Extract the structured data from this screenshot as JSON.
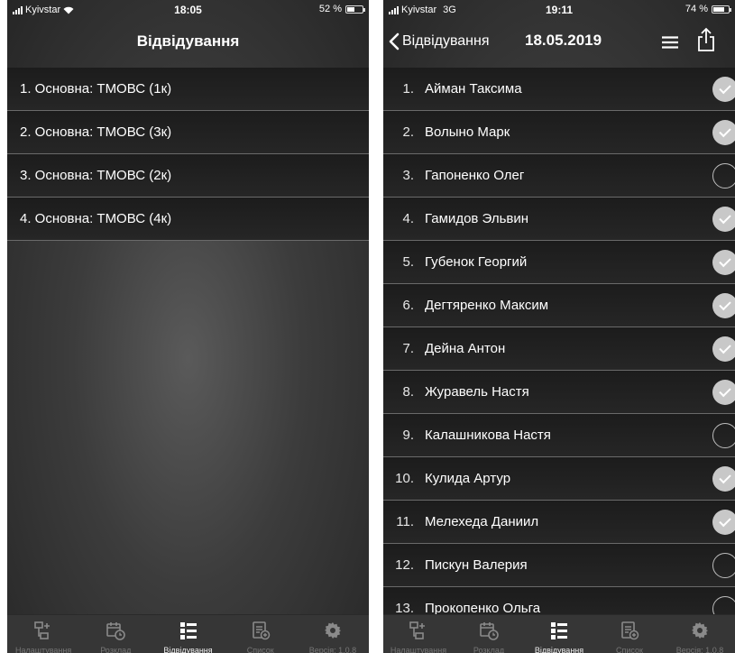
{
  "left": {
    "status": {
      "carrier": "Kyivstar",
      "time": "18:05",
      "battery": "52 %",
      "battery_level": 0.52
    },
    "title": "Відвідування",
    "groups": [
      "1. Основна: ТМОВС (1к)",
      "2. Основна: ТМОВС (3к)",
      "3. Основна: ТМОВС (2к)",
      "4. Основна: ТМОВС (4к)"
    ]
  },
  "right": {
    "status": {
      "carrier": "Kyivstar",
      "network": "3G",
      "time": "19:11",
      "battery": "74 %",
      "battery_level": 0.74
    },
    "back_label": "Відвідування",
    "date": "18.05.2019",
    "students": [
      {
        "num": "1.",
        "name": "Айман Таксима",
        "present": true
      },
      {
        "num": "2.",
        "name": "Волыно Марк",
        "present": true
      },
      {
        "num": "3.",
        "name": "Гапоненко Олег",
        "present": false
      },
      {
        "num": "4.",
        "name": "Гамидов Эльвин",
        "present": true
      },
      {
        "num": "5.",
        "name": "Губенок Георгий",
        "present": true
      },
      {
        "num": "6.",
        "name": "Дегтяренко Максим",
        "present": true
      },
      {
        "num": "7.",
        "name": "Дейна Антон",
        "present": true
      },
      {
        "num": "8.",
        "name": "Журавель Настя",
        "present": true
      },
      {
        "num": "9.",
        "name": "Калашникова Настя",
        "present": false
      },
      {
        "num": "10.",
        "name": "Кулида Артур",
        "present": true
      },
      {
        "num": "11.",
        "name": "Мелехеда Даниил",
        "present": true
      },
      {
        "num": "12.",
        "name": "Пискун Валерия",
        "present": false
      },
      {
        "num": "13.",
        "name": "Прокопенко Ольга",
        "present": false
      }
    ]
  },
  "tabs": [
    {
      "label": "Налаштування",
      "icon": "hierarchy-add-icon",
      "active": false
    },
    {
      "label": "Розклад",
      "icon": "calendar-clock-icon",
      "active": false
    },
    {
      "label": "Відвідування",
      "icon": "checklist-icon",
      "active": true
    },
    {
      "label": "Список",
      "icon": "document-add-icon",
      "active": false
    },
    {
      "label": "Версія: 1.0.8",
      "icon": "gear-icon",
      "active": false
    }
  ],
  "colors": {
    "row_divider": "#6a6a6a",
    "check_on": "#c8c8c8",
    "tabbar": "#363636"
  }
}
